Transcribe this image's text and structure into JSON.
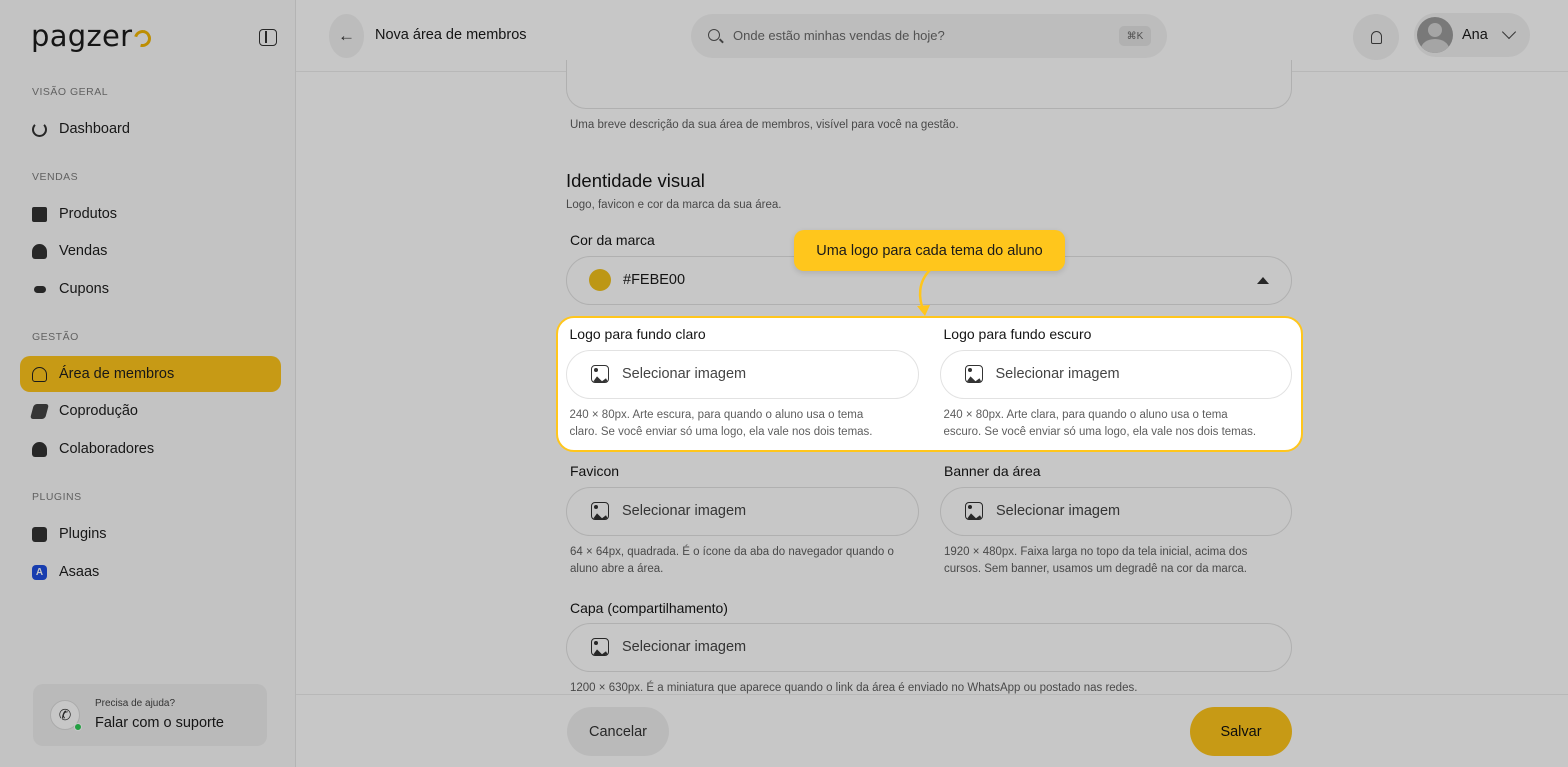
{
  "sidebar": {
    "brand": "pagzer",
    "sections": {
      "overview": "VISÃO GERAL",
      "sales": "VENDAS",
      "management": "GESTÃO",
      "plugins": "PLUGINS"
    },
    "items": {
      "dashboard": "Dashboard",
      "produtos": "Produtos",
      "vendas": "Vendas",
      "cupons": "Cupons",
      "area_membros": "Área de membros",
      "coproducao": "Coprodução",
      "colaboradores": "Colaboradores",
      "plugins": "Plugins",
      "asaas": "Asaas"
    },
    "asaas_icon_letter": "A",
    "help": {
      "question": "Precisa de ajuda?",
      "action": "Falar com o suporte"
    }
  },
  "header": {
    "title": "Nova área de membros",
    "search_placeholder": "Onde estão minhas vendas de hoje?",
    "search_shortcut": "⌘K",
    "user_name": "Ana"
  },
  "form": {
    "description_hint": "Uma breve descrição da sua área de membros, visível para você na gestão.",
    "visual_identity": {
      "title": "Identidade visual",
      "subtitle": "Logo, favicon e cor da marca da sua área."
    },
    "brand_color": {
      "label": "Cor da marca",
      "value": "#FEBE00",
      "swatch": "#f2c21c"
    },
    "upload_label": "Selecionar imagem",
    "logo_light": {
      "label": "Logo para fundo claro",
      "hint_line1": "240 × 80px. Arte escura, para quando o aluno usa o tema",
      "hint_line2": "claro. Se você enviar só uma logo, ela vale nos dois temas."
    },
    "logo_dark": {
      "label": "Logo para fundo escuro",
      "hint_line1": "240 × 80px. Arte clara, para quando o aluno usa o tema",
      "hint_line2": "escuro. Se você enviar só uma logo, ela vale nos dois temas."
    },
    "favicon": {
      "label": "Favicon",
      "hint_line1": "64 × 64px, quadrada. É o ícone da aba do navegador quando o",
      "hint_line2": "aluno abre a área."
    },
    "banner": {
      "label": "Banner da área",
      "hint_line1": "1920 × 480px. Faixa larga no topo da tela inicial, acima dos",
      "hint_line2": "cursos. Sem banner, usamos um degradê na cor da marca."
    },
    "cover": {
      "label": "Capa (compartilhamento)",
      "hint": "1200 × 630px. É a miniatura que aparece quando o link da área é enviado no WhatsApp ou postado nas redes."
    }
  },
  "footer": {
    "cancel": "Cancelar",
    "save": "Salvar"
  },
  "tooltip": {
    "text": "Uma logo para cada tema do aluno"
  },
  "colors": {
    "accent": "#ffc61c",
    "overlay": "rgba(0,0,0,0.22)"
  }
}
